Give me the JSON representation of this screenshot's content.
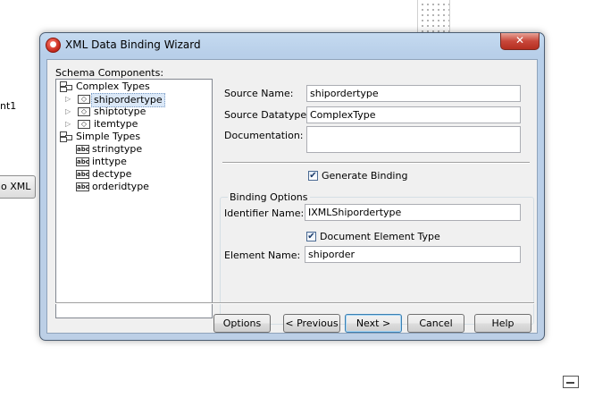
{
  "background": {
    "left_text": "nt1",
    "left_button": "o XML"
  },
  "window": {
    "title": "XML Data Binding Wizard",
    "close_glyph": "✕"
  },
  "tree": {
    "label": "Schema Components:",
    "items": [
      {
        "label": "Complex Types",
        "icon": "group-icon",
        "level": 0,
        "expander": ""
      },
      {
        "label": "shipordertype",
        "icon": "element-icon",
        "level": 1,
        "expander": "▷",
        "selected": true
      },
      {
        "label": "shiptotype",
        "icon": "element-icon",
        "level": 1,
        "expander": "▷"
      },
      {
        "label": "itemtype",
        "icon": "element-icon",
        "level": 1,
        "expander": "▷"
      },
      {
        "label": "Simple Types",
        "icon": "group-icon",
        "level": 0,
        "expander": ""
      },
      {
        "label": "stringtype",
        "icon": "abc-icon",
        "level": 1,
        "expander": ""
      },
      {
        "label": "inttype",
        "icon": "abc-icon",
        "level": 1,
        "expander": ""
      },
      {
        "label": "dectype",
        "icon": "abc-icon",
        "level": 1,
        "expander": ""
      },
      {
        "label": "orderidtype",
        "icon": "abc-icon",
        "level": 1,
        "expander": ""
      }
    ]
  },
  "fields": {
    "source_name_label": "Source Name:",
    "source_name_value": "shipordertype",
    "source_datatype_label": "Source Datatype:",
    "source_datatype_value": "ComplexType",
    "documentation_label": "Documentation:",
    "documentation_value": "",
    "generate_binding_label": "Generate Binding",
    "generate_binding_checked": true
  },
  "binding_options": {
    "title": "Binding Options",
    "identifier_label": "Identifier Name:",
    "identifier_value": "IXMLShipordertype",
    "document_element_label": "Document Element Type",
    "document_element_checked": true,
    "element_name_label": "Element Name:",
    "element_name_value": "shiporder"
  },
  "buttons": {
    "options": "Options",
    "previous": "< Previous",
    "next": "Next >",
    "cancel": "Cancel",
    "help": "Help"
  },
  "check_glyph": "✔"
}
